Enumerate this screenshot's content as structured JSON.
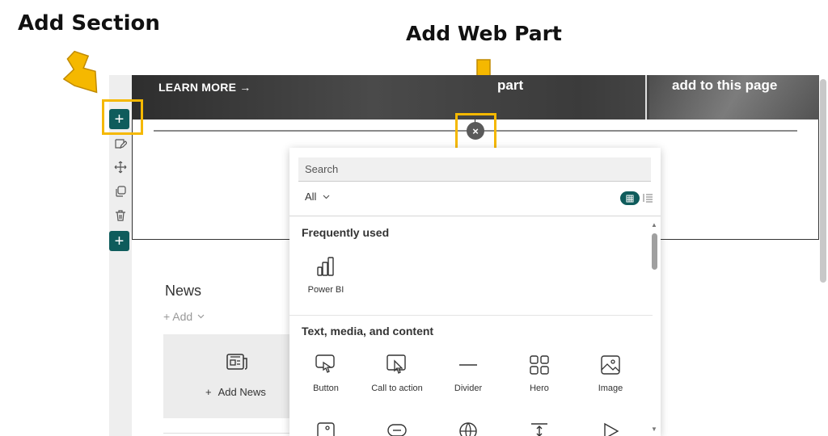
{
  "annotations": {
    "add_section": "Add Section",
    "add_web_part": "Add Web Part",
    "highlight_color": "#f5b800"
  },
  "hero": {
    "learn_more": "LEARN MORE →",
    "tile2_text": "part",
    "tile3_text": "add to this page"
  },
  "toolbar": {
    "add_symbol": "+",
    "accent": "#0f5c5c",
    "icons": [
      "edit-icon",
      "move-icon",
      "duplicate-icon",
      "delete-icon"
    ]
  },
  "close_symbol": "×",
  "news": {
    "title": "News",
    "add_label": "+ Add",
    "add_news_label": "Add News"
  },
  "picker": {
    "search_placeholder": "Search",
    "filter_label": "All",
    "sections": [
      {
        "title": "Frequently used",
        "items": [
          "Power BI"
        ]
      },
      {
        "title": "Text, media, and content",
        "items": [
          "Button",
          "Call to action",
          "Divider",
          "Hero",
          "Image"
        ]
      }
    ]
  }
}
